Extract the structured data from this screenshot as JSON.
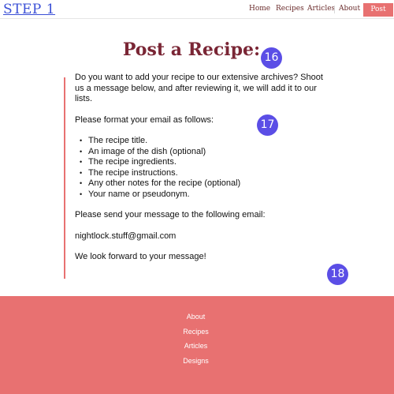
{
  "header": {
    "logo": "STEP 1",
    "nav": {
      "home": "Home",
      "recipes": "Recipes",
      "articles": "Articles",
      "about": "About",
      "post": "Post"
    }
  },
  "main": {
    "title": "Post a Recipe:",
    "intro": "Do you want to add your recipe to our extensive archives? Shoot us a message below, and after reviewing it, we will add it to our lists.",
    "format_prompt": "Please format your email as follows:",
    "format_items": [
      "The recipe title.",
      "An image of the dish (optional)",
      "The recipe ingredients.",
      "The recipe instructions.",
      "Any other notes for the recipe (optional)",
      "Your name or pseudonym."
    ],
    "send_prompt": "Please send your message to the following email:",
    "email": "nightlock.stuff@gmail.com",
    "closing": "We look forward to your message!"
  },
  "markers": [
    "16",
    "17",
    "18"
  ],
  "footer": {
    "links": [
      "About",
      "Recipes",
      "Articles",
      "Designs"
    ]
  },
  "colors": {
    "accent": "#e87171",
    "title": "#7a2635",
    "logo": "#3a4fd6",
    "marker": "#5b4ee6"
  }
}
